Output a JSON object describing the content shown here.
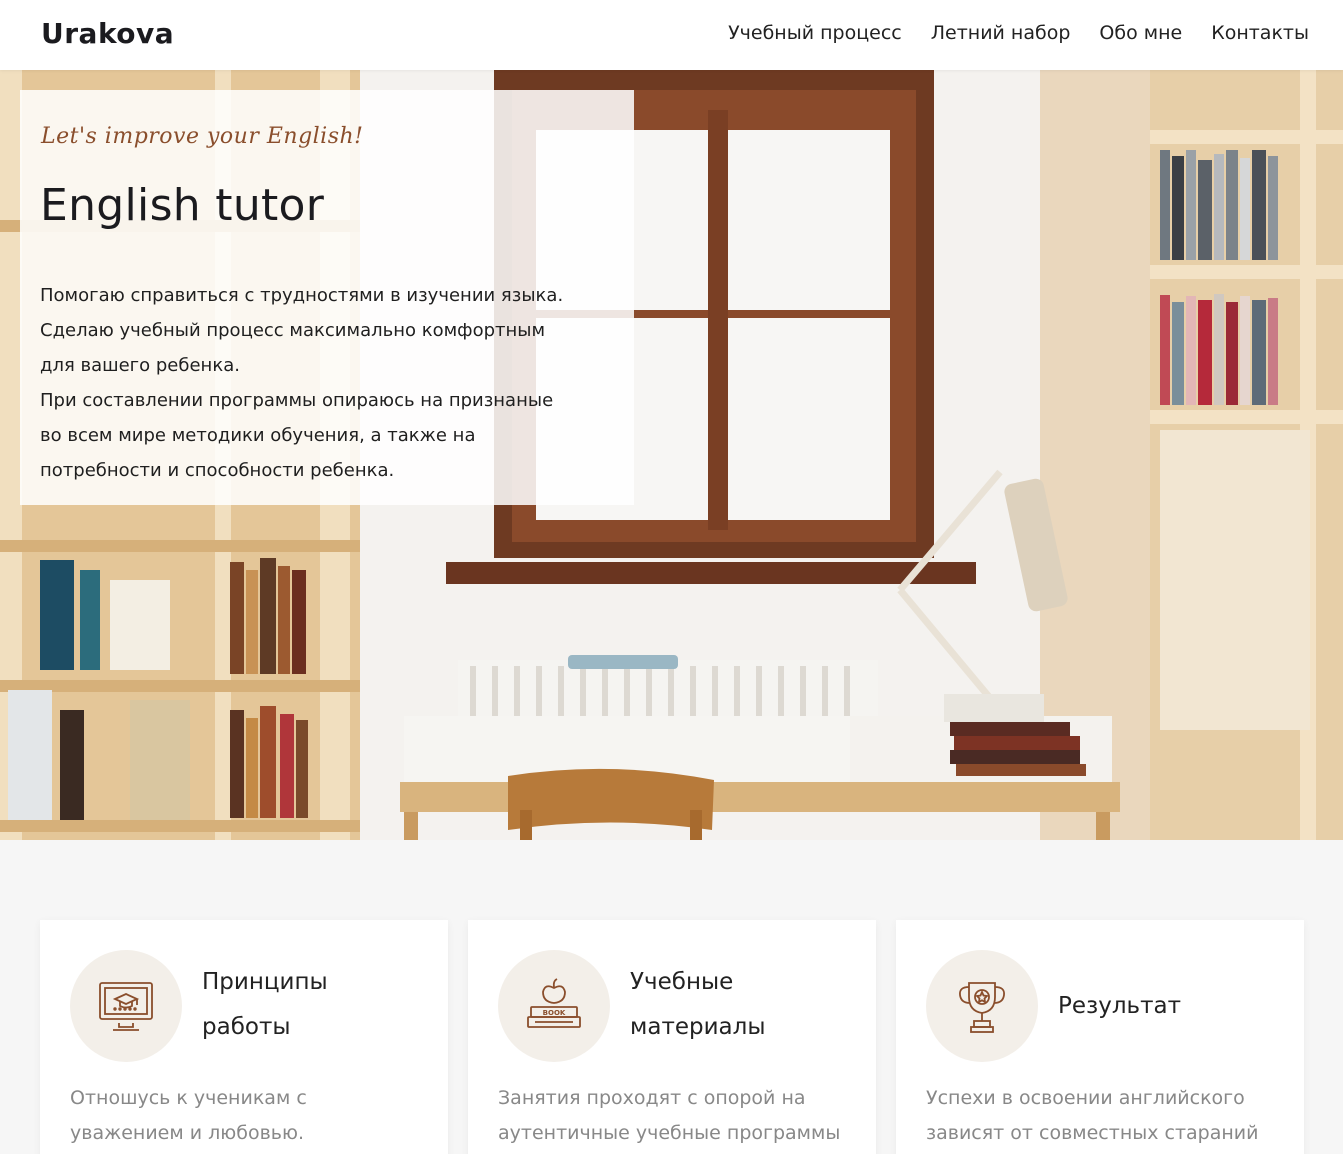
{
  "header": {
    "brand": "Urakova",
    "nav": [
      "Учебный процесс",
      "Летний набор",
      "Обо мне",
      "Контакты"
    ]
  },
  "hero": {
    "script": "Let's improve your English!",
    "title": "English tutor",
    "paragraphs": [
      "Помогаю справиться с трудностями в изучении языка.",
      "Сделаю учебный процесс максимально комфортным",
      "для вашего ребенка.",
      "При составлении программы опираюсь на признаные",
      "во всем мире методики обучения, а также на",
      "потребности и способности ребенка."
    ]
  },
  "cards": [
    {
      "icon": "computer-graduation-icon",
      "title_lines": [
        "Принципы",
        "работы"
      ],
      "text_lines": [
        "Отношусь к ученикам с",
        "уважением и любовью."
      ]
    },
    {
      "icon": "books-apple-icon",
      "title_lines": [
        "Учебные",
        "материалы"
      ],
      "text_lines": [
        "Занятия проходят с опорой на",
        "аутентичные учебные программы"
      ]
    },
    {
      "icon": "trophy-icon",
      "title_lines": [
        "Результат"
      ],
      "text_lines": [
        "Успехи в освоении английского",
        "зависят от совместных стараний"
      ]
    }
  ],
  "colors": {
    "accent": "#8a4e2c",
    "icon_bg": "#f3efe9",
    "muted_text": "#888888",
    "page_bg": "#f6f6f6"
  }
}
